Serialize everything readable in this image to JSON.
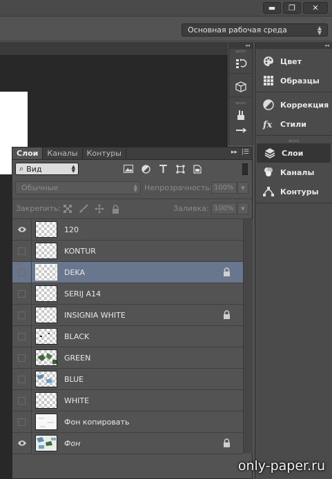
{
  "window": {
    "minimize_glyph": "▬",
    "restore_glyph": "❐",
    "close_glyph": "✕"
  },
  "options_bar": {
    "workspace_value": "Основная рабочая среда"
  },
  "right_dock": {
    "groups": [
      {
        "items": [
          {
            "label": "Цвет",
            "icon": "palette-icon"
          },
          {
            "label": "Образцы",
            "icon": "swatches-grid-icon"
          }
        ]
      },
      {
        "items": [
          {
            "label": "Коррекция",
            "icon": "adjustment-circle-icon"
          },
          {
            "label": "Стили",
            "icon": "fx-icon"
          }
        ]
      },
      {
        "items": [
          {
            "label": "Слои",
            "icon": "layers-stack-icon",
            "active": true
          },
          {
            "label": "Каналы",
            "icon": "channels-icon"
          },
          {
            "label": "Контуры",
            "icon": "paths-icon"
          }
        ]
      }
    ]
  },
  "layers_panel": {
    "tabs": [
      "Слои",
      "Каналы",
      "Контуры"
    ],
    "filter": {
      "kind_value": "Вид",
      "search_glyph": "⌕"
    },
    "blend_mode": "Обычные",
    "opacity_label": "Непрозрачность:",
    "opacity_value": "100%",
    "lock_label": "Закрепить:",
    "fill_label": "Заливка:",
    "fill_value": "100%",
    "layers": [
      {
        "name": "120",
        "visible": true,
        "locked": false,
        "selected": false,
        "italic": false
      },
      {
        "name": "KONTUR",
        "visible": false,
        "locked": false,
        "selected": false,
        "italic": false
      },
      {
        "name": "DEKA",
        "visible": false,
        "locked": true,
        "selected": true,
        "italic": false
      },
      {
        "name": "SERIJ A14",
        "visible": false,
        "locked": false,
        "selected": false,
        "italic": false
      },
      {
        "name": "INSIGNIA WHITE",
        "visible": false,
        "locked": true,
        "selected": false,
        "italic": false
      },
      {
        "name": "BLACK",
        "visible": false,
        "locked": false,
        "selected": false,
        "italic": false
      },
      {
        "name": "GREEN",
        "visible": false,
        "locked": false,
        "selected": false,
        "italic": false
      },
      {
        "name": "BLUE",
        "visible": false,
        "locked": false,
        "selected": false,
        "italic": false
      },
      {
        "name": "WHITE",
        "visible": false,
        "locked": false,
        "selected": false,
        "italic": false
      },
      {
        "name": "Фон копировать",
        "visible": false,
        "locked": false,
        "selected": false,
        "italic": false
      },
      {
        "name": "Фон",
        "visible": true,
        "locked": true,
        "selected": false,
        "italic": true
      }
    ]
  },
  "watermark": "only-paper.ru",
  "colors": {
    "selected_row": "#68778d",
    "panel_bg": "#535353",
    "document_bg": "#282828"
  }
}
